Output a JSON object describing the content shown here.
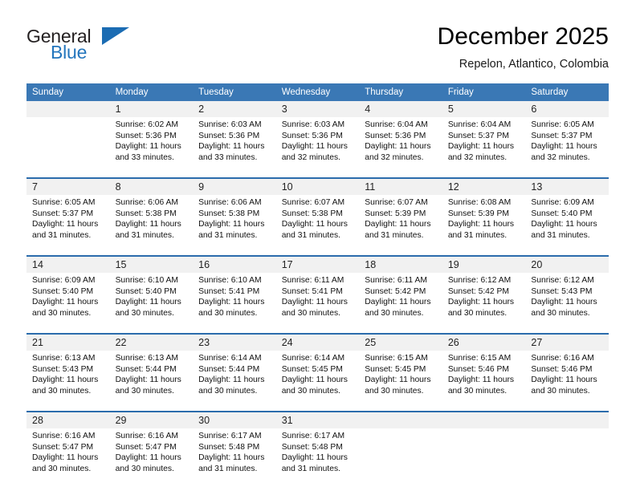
{
  "brand": {
    "name_part1": "General",
    "name_part2": "Blue",
    "accent_color": "#2476bd",
    "triangle_icon": "triangle-icon"
  },
  "header": {
    "title": "December 2025",
    "subtitle": "Repelon, Atlantico, Colombia"
  },
  "calendar": {
    "header_color": "#3a78b5",
    "weekdays": [
      "Sunday",
      "Monday",
      "Tuesday",
      "Wednesday",
      "Thursday",
      "Friday",
      "Saturday"
    ],
    "weeks": [
      [
        {
          "day": "",
          "lines": []
        },
        {
          "day": "1",
          "lines": [
            "Sunrise: 6:02 AM",
            "Sunset: 5:36 PM",
            "Daylight: 11 hours and 33 minutes."
          ]
        },
        {
          "day": "2",
          "lines": [
            "Sunrise: 6:03 AM",
            "Sunset: 5:36 PM",
            "Daylight: 11 hours and 33 minutes."
          ]
        },
        {
          "day": "3",
          "lines": [
            "Sunrise: 6:03 AM",
            "Sunset: 5:36 PM",
            "Daylight: 11 hours and 32 minutes."
          ]
        },
        {
          "day": "4",
          "lines": [
            "Sunrise: 6:04 AM",
            "Sunset: 5:36 PM",
            "Daylight: 11 hours and 32 minutes."
          ]
        },
        {
          "day": "5",
          "lines": [
            "Sunrise: 6:04 AM",
            "Sunset: 5:37 PM",
            "Daylight: 11 hours and 32 minutes."
          ]
        },
        {
          "day": "6",
          "lines": [
            "Sunrise: 6:05 AM",
            "Sunset: 5:37 PM",
            "Daylight: 11 hours and 32 minutes."
          ]
        }
      ],
      [
        {
          "day": "7",
          "lines": [
            "Sunrise: 6:05 AM",
            "Sunset: 5:37 PM",
            "Daylight: 11 hours and 31 minutes."
          ]
        },
        {
          "day": "8",
          "lines": [
            "Sunrise: 6:06 AM",
            "Sunset: 5:38 PM",
            "Daylight: 11 hours and 31 minutes."
          ]
        },
        {
          "day": "9",
          "lines": [
            "Sunrise: 6:06 AM",
            "Sunset: 5:38 PM",
            "Daylight: 11 hours and 31 minutes."
          ]
        },
        {
          "day": "10",
          "lines": [
            "Sunrise: 6:07 AM",
            "Sunset: 5:38 PM",
            "Daylight: 11 hours and 31 minutes."
          ]
        },
        {
          "day": "11",
          "lines": [
            "Sunrise: 6:07 AM",
            "Sunset: 5:39 PM",
            "Daylight: 11 hours and 31 minutes."
          ]
        },
        {
          "day": "12",
          "lines": [
            "Sunrise: 6:08 AM",
            "Sunset: 5:39 PM",
            "Daylight: 11 hours and 31 minutes."
          ]
        },
        {
          "day": "13",
          "lines": [
            "Sunrise: 6:09 AM",
            "Sunset: 5:40 PM",
            "Daylight: 11 hours and 31 minutes."
          ]
        }
      ],
      [
        {
          "day": "14",
          "lines": [
            "Sunrise: 6:09 AM",
            "Sunset: 5:40 PM",
            "Daylight: 11 hours and 30 minutes."
          ]
        },
        {
          "day": "15",
          "lines": [
            "Sunrise: 6:10 AM",
            "Sunset: 5:40 PM",
            "Daylight: 11 hours and 30 minutes."
          ]
        },
        {
          "day": "16",
          "lines": [
            "Sunrise: 6:10 AM",
            "Sunset: 5:41 PM",
            "Daylight: 11 hours and 30 minutes."
          ]
        },
        {
          "day": "17",
          "lines": [
            "Sunrise: 6:11 AM",
            "Sunset: 5:41 PM",
            "Daylight: 11 hours and 30 minutes."
          ]
        },
        {
          "day": "18",
          "lines": [
            "Sunrise: 6:11 AM",
            "Sunset: 5:42 PM",
            "Daylight: 11 hours and 30 minutes."
          ]
        },
        {
          "day": "19",
          "lines": [
            "Sunrise: 6:12 AM",
            "Sunset: 5:42 PM",
            "Daylight: 11 hours and 30 minutes."
          ]
        },
        {
          "day": "20",
          "lines": [
            "Sunrise: 6:12 AM",
            "Sunset: 5:43 PM",
            "Daylight: 11 hours and 30 minutes."
          ]
        }
      ],
      [
        {
          "day": "21",
          "lines": [
            "Sunrise: 6:13 AM",
            "Sunset: 5:43 PM",
            "Daylight: 11 hours and 30 minutes."
          ]
        },
        {
          "day": "22",
          "lines": [
            "Sunrise: 6:13 AM",
            "Sunset: 5:44 PM",
            "Daylight: 11 hours and 30 minutes."
          ]
        },
        {
          "day": "23",
          "lines": [
            "Sunrise: 6:14 AM",
            "Sunset: 5:44 PM",
            "Daylight: 11 hours and 30 minutes."
          ]
        },
        {
          "day": "24",
          "lines": [
            "Sunrise: 6:14 AM",
            "Sunset: 5:45 PM",
            "Daylight: 11 hours and 30 minutes."
          ]
        },
        {
          "day": "25",
          "lines": [
            "Sunrise: 6:15 AM",
            "Sunset: 5:45 PM",
            "Daylight: 11 hours and 30 minutes."
          ]
        },
        {
          "day": "26",
          "lines": [
            "Sunrise: 6:15 AM",
            "Sunset: 5:46 PM",
            "Daylight: 11 hours and 30 minutes."
          ]
        },
        {
          "day": "27",
          "lines": [
            "Sunrise: 6:16 AM",
            "Sunset: 5:46 PM",
            "Daylight: 11 hours and 30 minutes."
          ]
        }
      ],
      [
        {
          "day": "28",
          "lines": [
            "Sunrise: 6:16 AM",
            "Sunset: 5:47 PM",
            "Daylight: 11 hours and 30 minutes."
          ]
        },
        {
          "day": "29",
          "lines": [
            "Sunrise: 6:16 AM",
            "Sunset: 5:47 PM",
            "Daylight: 11 hours and 30 minutes."
          ]
        },
        {
          "day": "30",
          "lines": [
            "Sunrise: 6:17 AM",
            "Sunset: 5:48 PM",
            "Daylight: 11 hours and 31 minutes."
          ]
        },
        {
          "day": "31",
          "lines": [
            "Sunrise: 6:17 AM",
            "Sunset: 5:48 PM",
            "Daylight: 11 hours and 31 minutes."
          ]
        },
        {
          "day": "",
          "lines": []
        },
        {
          "day": "",
          "lines": []
        },
        {
          "day": "",
          "lines": []
        }
      ]
    ]
  }
}
